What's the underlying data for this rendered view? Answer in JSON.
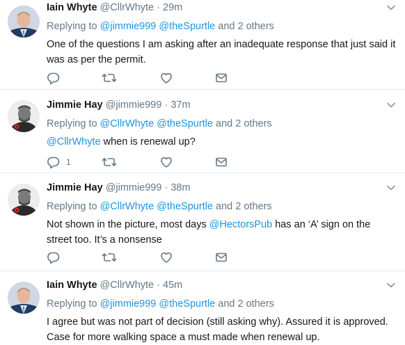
{
  "tweets": [
    {
      "name": "Iain Whyte",
      "handle": "@CllrWhyte",
      "sep": " · ",
      "time": "29m",
      "reply_prefix": "Replying to",
      "reply_m1": "@jimmie999",
      "reply_m2": "@theSpurtle",
      "reply_suffix": "and 2 others",
      "text_parts": [
        "One of the questions I am asking after an inadequate response that just said it was as per the permit."
      ],
      "reply_count": ""
    },
    {
      "name": "Jimmie Hay",
      "handle": "@jimmie999",
      "sep": " · ",
      "time": "37m",
      "reply_prefix": "Replying to",
      "reply_m1": "@CllrWhyte",
      "reply_m2": "@theSpurtle",
      "reply_suffix": "and 2 others",
      "text_mention": "@CllrWhyte",
      "text_after": " when is renewal up?",
      "reply_count": "1"
    },
    {
      "name": "Jimmie Hay",
      "handle": "@jimmie999",
      "sep": " · ",
      "time": "38m",
      "reply_prefix": "Replying to",
      "reply_m1": "@CllrWhyte",
      "reply_m2": "@theSpurtle",
      "reply_suffix": "and 2 others",
      "text_before": "Not shown in the picture, most days ",
      "text_mention": "@HectorsPub",
      "text_after": " has an ‘A’ sign on the street too. It’s a nonsense",
      "reply_count": ""
    },
    {
      "name": "Iain Whyte",
      "handle": "@CllrWhyte",
      "sep": " · ",
      "time": "45m",
      "reply_prefix": "Replying to",
      "reply_m1": "@jimmie999",
      "reply_m2": "@theSpurtle",
      "reply_suffix": "and 2 others",
      "text_parts": [
        "I agree but was not part of decision (still asking why). Assured it is approved. Case for more walking space a must made when renewal up."
      ],
      "reply_count": ""
    }
  ],
  "icons": [
    "chevron-down-icon",
    "reply-icon",
    "retweet-icon",
    "like-icon",
    "message-icon"
  ],
  "colors": {
    "link": "#1b95e0",
    "muted": "#657786",
    "text": "#14171a",
    "divider": "#e6ecf0"
  }
}
